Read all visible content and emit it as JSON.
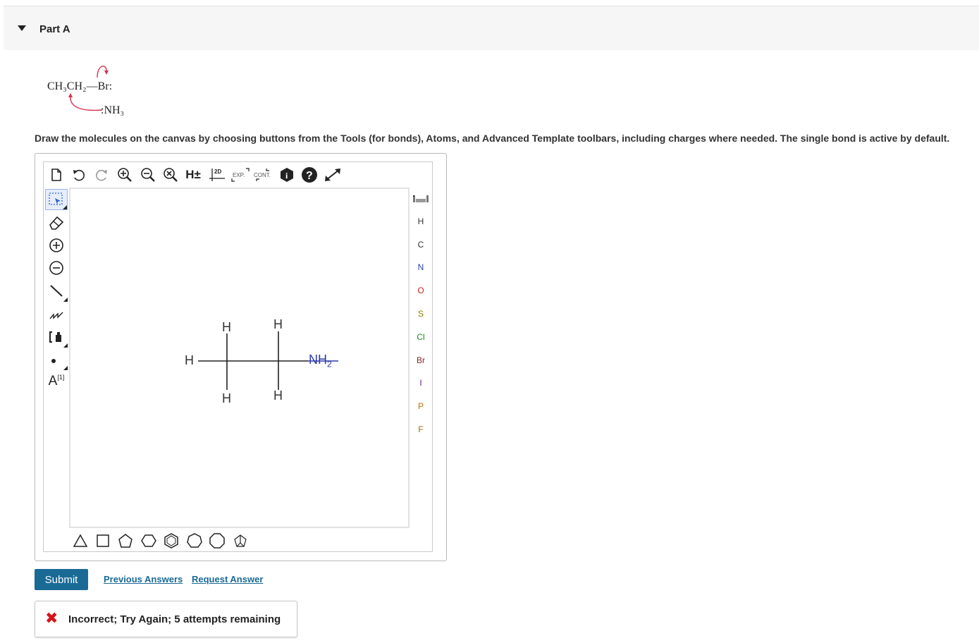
{
  "part": {
    "title": "Part A"
  },
  "mechanism": {
    "substrate": "CH₃CH₂—Br:",
    "nucleophile": ":NH₃",
    "arrow_color": "#d2314b"
  },
  "instructions": "Draw the molecules on the canvas by choosing buttons from the Tools (for bonds), Atoms, and Advanced Template toolbars, including charges where needed. The single bond is active by default.",
  "top_toolbar": {
    "h_toggle_label": "H±",
    "two_d_label": "2D",
    "exp_label": "EXP.",
    "cont_label": "CONT."
  },
  "canvas": {
    "atoms": {
      "h_left": "H",
      "h_top_1": "H",
      "h_top_2": "H",
      "h_bottom_1": "H",
      "h_bottom_2": "H",
      "nh2_main": "NH",
      "nh2_sub": "2"
    }
  },
  "atoms_toolbar": [
    {
      "symbol": "H",
      "color": "#333333"
    },
    {
      "symbol": "C",
      "color": "#333333"
    },
    {
      "symbol": "N",
      "color": "#2d3aa8"
    },
    {
      "symbol": "O",
      "color": "#d22222"
    },
    {
      "symbol": "S",
      "color": "#8a7a00"
    },
    {
      "symbol": "Cl",
      "color": "#1b8a1b"
    },
    {
      "symbol": "Br",
      "color": "#7a2a2a"
    },
    {
      "symbol": "I",
      "color": "#6a1a8a"
    },
    {
      "symbol": "P",
      "color": "#c86a00"
    },
    {
      "symbol": "F",
      "color": "#a06a00"
    }
  ],
  "left_toolbar": {
    "atom_map_label": "A",
    "atom_map_sup": "[1]"
  },
  "actions": {
    "submit": "Submit",
    "previous_answers": "Previous Answers",
    "request_answer": "Request Answer"
  },
  "feedback": {
    "icon": "✖",
    "message": "Incorrect; Try Again; 5 attempts remaining",
    "icon_color": "#d3161c"
  }
}
